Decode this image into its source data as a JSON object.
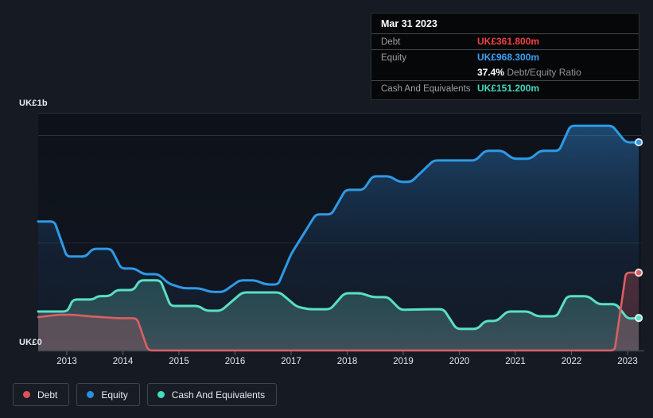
{
  "tooltip": {
    "date": "Mar 31 2023",
    "debt_label": "Debt",
    "debt_value": "UK£361.800m",
    "equity_label": "Equity",
    "equity_value": "UK£968.300m",
    "ratio_value": "37.4%",
    "ratio_label": "Debt/Equity Ratio",
    "cash_label": "Cash And Equivalents",
    "cash_value": "UK£151.200m"
  },
  "axis": {
    "y_top_label": "UK£1b",
    "y_bottom_label": "UK£0",
    "x_tick_labels": [
      "2013",
      "2014",
      "2015",
      "2016",
      "2017",
      "2018",
      "2019",
      "2020",
      "2021",
      "2022",
      "2023"
    ]
  },
  "legend": {
    "items": [
      {
        "label": "Debt",
        "color": "#e05255"
      },
      {
        "label": "Equity",
        "color": "#2b90dc"
      },
      {
        "label": "Cash And Equivalents",
        "color": "#43dcc0"
      }
    ]
  },
  "colors": {
    "background": "#151a23",
    "debt_text": "#f14343",
    "equity_text": "#3aa1f7",
    "cash_text": "#45d9c1"
  },
  "chart_data": {
    "type": "area",
    "unit": "UK£ millions",
    "x_range": [
      2012.49,
      2023.2
    ],
    "y_gridlines_m": [
      1000,
      500,
      0
    ],
    "legend_position": "bottom-left",
    "latest": {
      "date": "Mar 31 2023",
      "debt_m": 361.8,
      "equity_m": 968.3,
      "debt_equity_ratio_pct": 37.4,
      "cash_m": 151.2
    },
    "series": [
      {
        "name": "Debt",
        "color": "#da5f63",
        "points": [
          [
            2012.49,
            155
          ],
          [
            2012.85,
            166
          ],
          [
            2013.1,
            166
          ],
          [
            2013.45,
            158
          ],
          [
            2013.9,
            150
          ],
          [
            2014.25,
            150
          ],
          [
            2014.45,
            0
          ],
          [
            2022.77,
            0
          ],
          [
            2022.97,
            361.8
          ],
          [
            2023.2,
            361.8
          ]
        ]
      },
      {
        "name": "Equity",
        "color": "#2e9ae6",
        "points": [
          [
            2012.49,
            600
          ],
          [
            2012.78,
            600
          ],
          [
            2013.0,
            437
          ],
          [
            2013.34,
            437
          ],
          [
            2013.46,
            473
          ],
          [
            2013.79,
            473
          ],
          [
            2013.97,
            381
          ],
          [
            2014.21,
            381
          ],
          [
            2014.37,
            355
          ],
          [
            2014.63,
            355
          ],
          [
            2014.82,
            311
          ],
          [
            2015.08,
            289
          ],
          [
            2015.37,
            289
          ],
          [
            2015.57,
            272
          ],
          [
            2015.79,
            272
          ],
          [
            2016.08,
            326
          ],
          [
            2016.36,
            326
          ],
          [
            2016.55,
            307
          ],
          [
            2016.77,
            307
          ],
          [
            2017.0,
            448
          ],
          [
            2017.44,
            633
          ],
          [
            2017.72,
            633
          ],
          [
            2017.97,
            747
          ],
          [
            2018.29,
            747
          ],
          [
            2018.45,
            810
          ],
          [
            2018.76,
            810
          ],
          [
            2018.93,
            784
          ],
          [
            2019.14,
            784
          ],
          [
            2019.54,
            884
          ],
          [
            2020.29,
            884
          ],
          [
            2020.46,
            929
          ],
          [
            2020.77,
            929
          ],
          [
            2020.95,
            892
          ],
          [
            2021.27,
            892
          ],
          [
            2021.44,
            929
          ],
          [
            2021.78,
            929
          ],
          [
            2021.98,
            1045
          ],
          [
            2022.73,
            1045
          ],
          [
            2022.97,
            968.3
          ],
          [
            2023.2,
            968.3
          ]
        ]
      },
      {
        "name": "Cash And Equivalents",
        "color": "#59dfc6",
        "points": [
          [
            2012.49,
            181
          ],
          [
            2013.01,
            181
          ],
          [
            2013.11,
            237
          ],
          [
            2013.47,
            237
          ],
          [
            2013.55,
            253
          ],
          [
            2013.77,
            253
          ],
          [
            2013.88,
            281
          ],
          [
            2014.19,
            281
          ],
          [
            2014.3,
            326
          ],
          [
            2014.67,
            326
          ],
          [
            2014.85,
            207
          ],
          [
            2015.35,
            207
          ],
          [
            2015.48,
            185
          ],
          [
            2015.75,
            185
          ],
          [
            2016.13,
            270
          ],
          [
            2016.8,
            270
          ],
          [
            2017.1,
            204
          ],
          [
            2017.3,
            192
          ],
          [
            2017.7,
            192
          ],
          [
            2017.95,
            266
          ],
          [
            2018.26,
            266
          ],
          [
            2018.45,
            248
          ],
          [
            2018.73,
            248
          ],
          [
            2018.95,
            189
          ],
          [
            2019.45,
            192
          ],
          [
            2019.72,
            192
          ],
          [
            2019.95,
            100
          ],
          [
            2020.32,
            100
          ],
          [
            2020.46,
            137
          ],
          [
            2020.67,
            137
          ],
          [
            2020.85,
            181
          ],
          [
            2021.24,
            181
          ],
          [
            2021.38,
            159
          ],
          [
            2021.74,
            159
          ],
          [
            2021.92,
            252
          ],
          [
            2022.3,
            252
          ],
          [
            2022.48,
            215
          ],
          [
            2022.8,
            215
          ],
          [
            2023.0,
            148
          ],
          [
            2023.2,
            151.2
          ]
        ]
      }
    ]
  }
}
